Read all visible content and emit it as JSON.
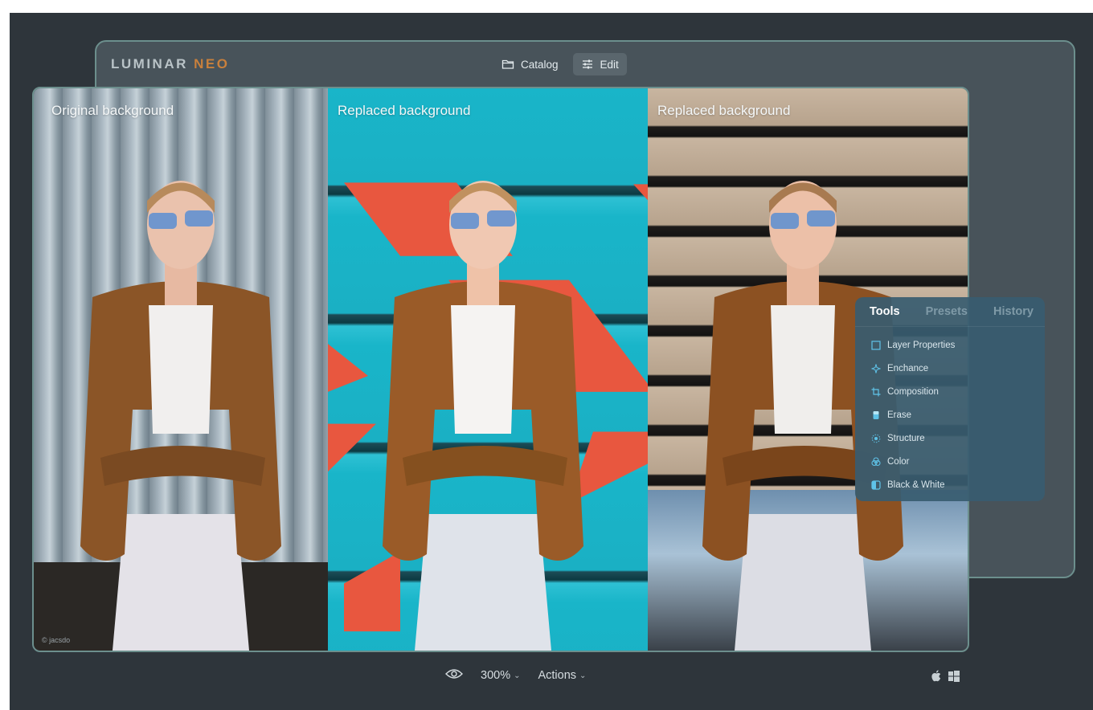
{
  "app": {
    "logo_main": "LUMINAR",
    "logo_accent": "NEO"
  },
  "top_nav": [
    {
      "label": "Catalog",
      "icon": "folder-icon",
      "active": false
    },
    {
      "label": "Edit",
      "icon": "sliders-icon",
      "active": true
    }
  ],
  "panels": [
    {
      "label": "Original background",
      "background": "corrugated-metal"
    },
    {
      "label": "Replaced background",
      "background": "teal-wall-with-red-triangles"
    },
    {
      "label": "Replaced background",
      "background": "concrete-building-with-sky"
    }
  ],
  "watermark": "© jacsdo",
  "tools_panel": {
    "tabs": [
      "Tools",
      "Presets",
      "History"
    ],
    "active_tab": "Tools",
    "items": [
      {
        "label": "Layer Properties",
        "icon": "layer-properties-icon"
      },
      {
        "label": "Enchance",
        "icon": "enhance-sparkle-icon"
      },
      {
        "label": "Composition",
        "icon": "crop-icon"
      },
      {
        "label": "Erase",
        "icon": "eraser-icon"
      },
      {
        "label": "Structure",
        "icon": "structure-icon"
      },
      {
        "label": "Color",
        "icon": "color-palette-icon"
      },
      {
        "label": "Black & White",
        "icon": "black-white-icon"
      }
    ]
  },
  "bottom_bar": {
    "view_icon": "eye-icon",
    "zoom": "300%",
    "actions_label": "Actions"
  },
  "os_icons": [
    "apple-icon",
    "windows-icon"
  ],
  "colors": {
    "background": "#2e353b",
    "window": "#48535a",
    "border_accent": "#6c8f8d",
    "logo_accent": "#c9803c",
    "tools_panel": "#385c70"
  }
}
